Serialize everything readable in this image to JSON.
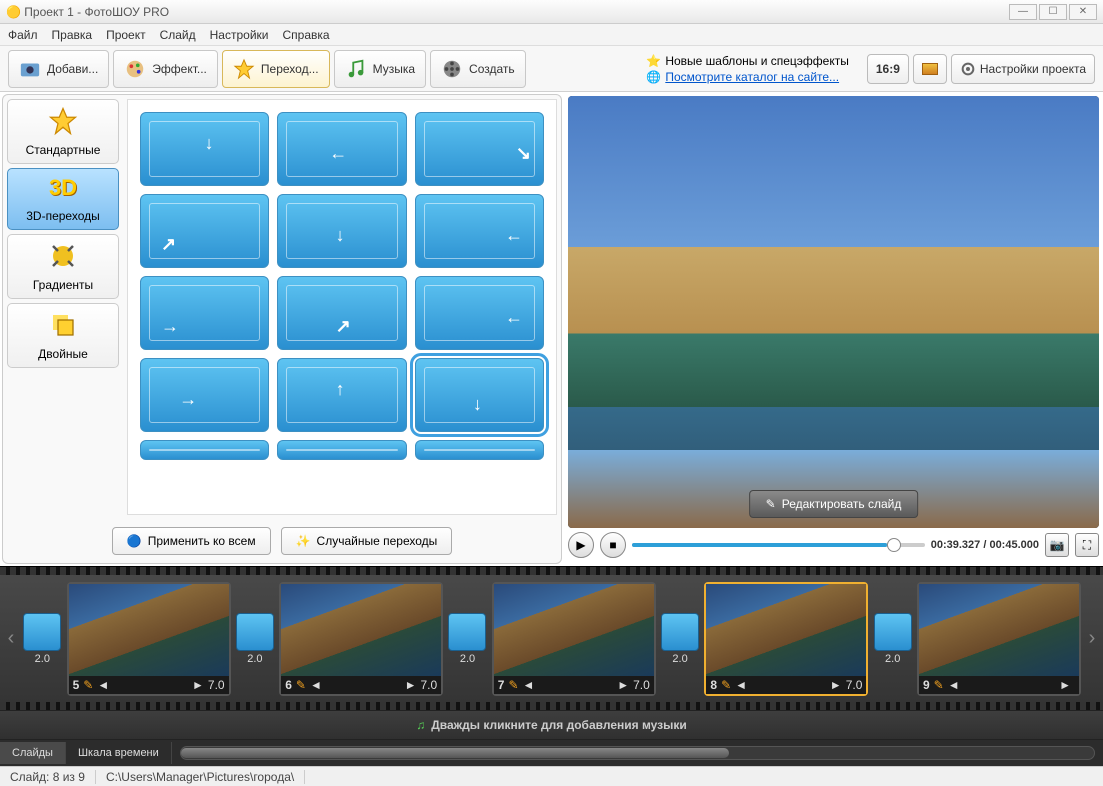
{
  "window": {
    "title": "Проект 1 - ФотоШОУ PRO"
  },
  "menu": {
    "file": "Файл",
    "edit": "Правка",
    "project": "Проект",
    "slide": "Слайд",
    "settings": "Настройки",
    "help": "Справка"
  },
  "tabs": {
    "add": "Добави...",
    "effects": "Эффект...",
    "transitions": "Переход...",
    "music": "Музыка",
    "create": "Создать"
  },
  "links": {
    "templates": "Новые шаблоны и спецэффекты",
    "catalog": "Посмотрите каталог на сайте..."
  },
  "rt": {
    "aspect": "16:9",
    "proj_settings": "Настройки проекта"
  },
  "categories": {
    "standard": "Стандартные",
    "threed": "3D-переходы",
    "gradients": "Градиенты",
    "double": "Двойные"
  },
  "buttons": {
    "apply_all": "Применить ко всем",
    "random": "Случайные переходы",
    "edit_slide": "Редактировать слайд"
  },
  "playback": {
    "time": "00:39.327 / 00:45.000"
  },
  "timeline": {
    "music_hint": "Дважды кликните для добавления музыки",
    "tab_slides": "Слайды",
    "tab_time": "Шкала времени",
    "slides": [
      {
        "n": "5",
        "dur": "7.0",
        "trans": "2.0"
      },
      {
        "n": "6",
        "dur": "7.0",
        "trans": "2.0"
      },
      {
        "n": "7",
        "dur": "7.0",
        "trans": "2.0"
      },
      {
        "n": "8",
        "dur": "7.0",
        "trans": "2.0",
        "sel": true
      },
      {
        "n": "9",
        "dur": "",
        "trans": "2.0"
      }
    ]
  },
  "status": {
    "slide": "Слайд: 8 из 9",
    "path": "C:\\Users\\Manager\\Pictures\\города\\"
  }
}
